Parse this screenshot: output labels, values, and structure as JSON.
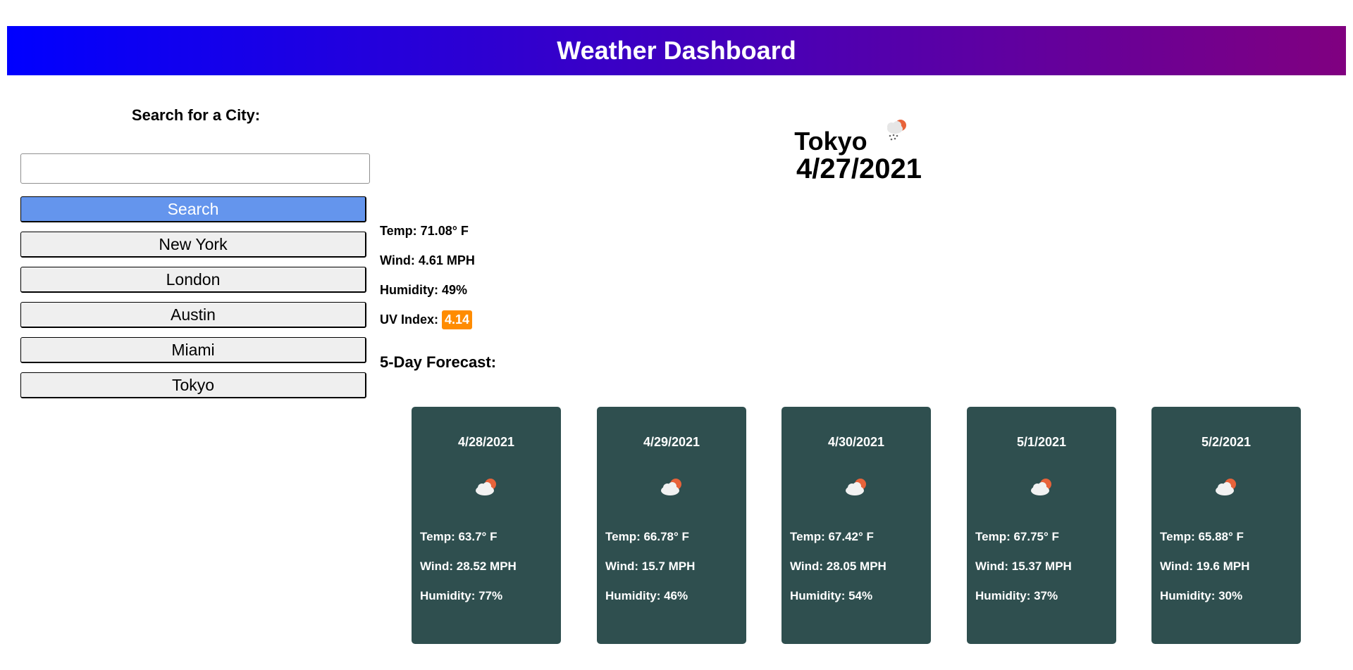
{
  "header": {
    "title": "Weather Dashboard"
  },
  "search": {
    "label": "Search for a City:",
    "input_value": "",
    "button_label": "Search"
  },
  "history": [
    "New York",
    "London",
    "Austin",
    "Miami",
    "Tokyo"
  ],
  "current": {
    "city": "Tokyo",
    "date": "4/27/2021",
    "icon": "snow-sun-icon",
    "temp": "Temp: 71.08° F",
    "wind": "Wind: 4.61 MPH",
    "humidity": "Humidity: 49%",
    "uv_label": "UV Index: ",
    "uv_value": "4.14",
    "uv_color": "#ff8c00"
  },
  "forecast_title": "5-Day Forecast:",
  "forecast": [
    {
      "date": "4/28/2021",
      "icon": "partly-cloudy-icon",
      "temp": "Temp: 63.7° F",
      "wind": "Wind: 28.52 MPH",
      "humidity": "Humidity: 77%"
    },
    {
      "date": "4/29/2021",
      "icon": "partly-cloudy-icon",
      "temp": "Temp: 66.78° F",
      "wind": "Wind: 15.7 MPH",
      "humidity": "Humidity: 46%"
    },
    {
      "date": "4/30/2021",
      "icon": "partly-cloudy-icon",
      "temp": "Temp: 67.42° F",
      "wind": "Wind: 28.05 MPH",
      "humidity": "Humidity: 54%"
    },
    {
      "date": "5/1/2021",
      "icon": "partly-cloudy-icon",
      "temp": "Temp: 67.75° F",
      "wind": "Wind: 15.37 MPH",
      "humidity": "Humidity: 37%"
    },
    {
      "date": "5/2/2021",
      "icon": "partly-cloudy-icon",
      "temp": "Temp: 65.88° F",
      "wind": "Wind: 19.6 MPH",
      "humidity": "Humidity: 30%"
    }
  ],
  "colors": {
    "header_start": "#0000ff",
    "header_end": "#800080",
    "search_button": "#6495ed",
    "card_bg": "#2f4f4f"
  }
}
